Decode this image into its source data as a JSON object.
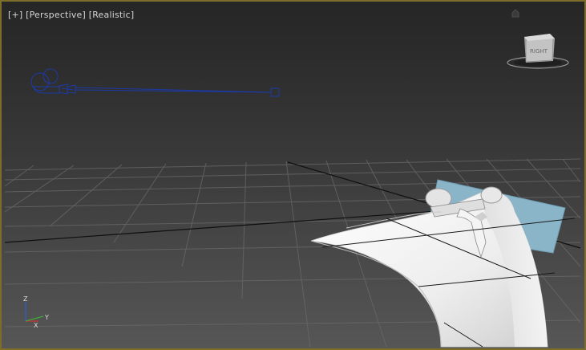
{
  "viewport": {
    "menu_label": "[+]",
    "view_label": "[Perspective]",
    "shading_label": "[Realistic]"
  },
  "viewcube": {
    "face_label": "RIGHT"
  },
  "axis_tripod": {
    "z": "Z",
    "x": "X",
    "y": "Y"
  },
  "colors": {
    "border": "#7d6d2a",
    "selection": "#1c3aa8",
    "grid": "#6a6a6a",
    "model": "#f2f2f2",
    "plane": "#8ab4c8"
  },
  "icons": [
    "home-icon",
    "viewcube-icon",
    "camera-icon",
    "axis-tripod-icon"
  ]
}
